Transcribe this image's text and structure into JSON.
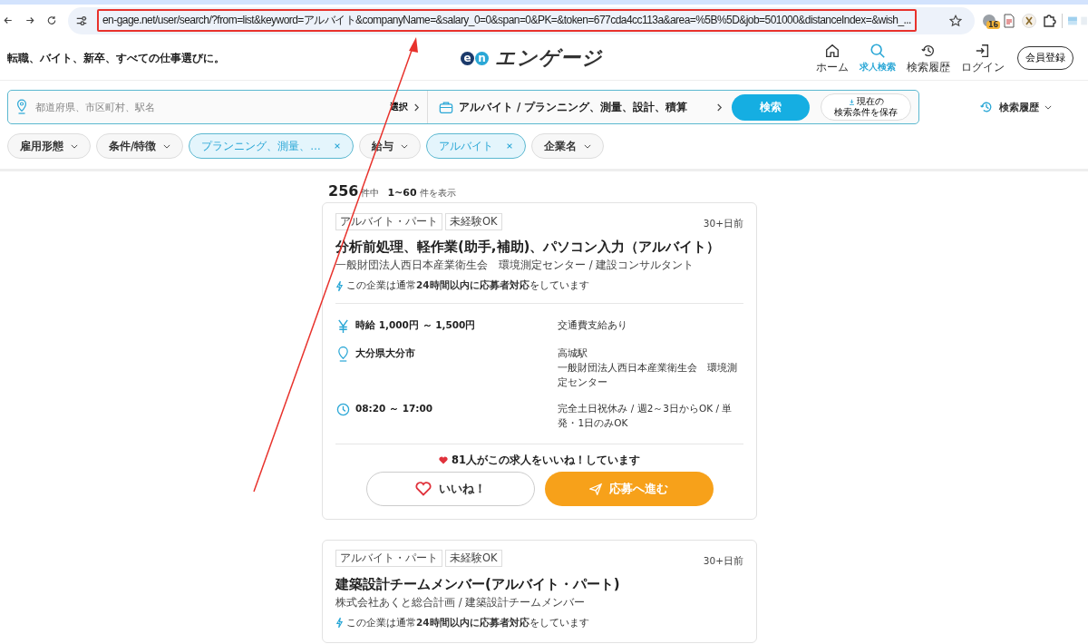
{
  "browser": {
    "url": "en-gage.net/user/search/?from=list&keyword=アルバイト&companyName=&salary_0=0&span=0&PK=&token=677cda4cc113a&area=%5B%5D&job=501000&distanceIndex=&wish_...",
    "extension_badge": "16"
  },
  "header": {
    "tagline": "転職、バイト、新卒、すべての仕事選びに。",
    "logo_mark": [
      "e",
      "n"
    ],
    "logo_text": "エンゲージ",
    "register_button": "会員登録",
    "nav": [
      {
        "label": "ホーム",
        "kind": "home",
        "selected": false
      },
      {
        "label": "求人検索",
        "kind": "search",
        "selected": true
      },
      {
        "label": "検索履歴",
        "kind": "history",
        "selected": false
      },
      {
        "label": "ログイン",
        "kind": "login",
        "selected": false
      }
    ]
  },
  "search": {
    "location_placeholder": "都道府県、市区町村、駅名",
    "location_select": "選択",
    "job_category": "アルバイト / プランニング、測量、設計、積算",
    "search_button": "検索",
    "save_button": [
      "現在の",
      "検索条件を保存"
    ],
    "history": "検索履歴"
  },
  "filters": [
    {
      "label": "雇用形態",
      "active": false
    },
    {
      "label": "条件/特徴",
      "active": false
    },
    {
      "label": "プランニング、測量、…",
      "active": true
    },
    {
      "label": "給与",
      "active": false
    },
    {
      "label": "アルバイト",
      "active": true
    },
    {
      "label": "企業名",
      "active": false
    }
  ],
  "results": {
    "total": "256",
    "total_suffix": "件中",
    "range": "1~60",
    "range_suffix": "件を表示"
  },
  "jobs": [
    {
      "tags": [
        "アルバイト・パート",
        "未経験OK"
      ],
      "posted": "30+日前",
      "title": "分析前処理、軽作業(助手,補助)、パソコン入力（アルバイト）",
      "company": "一般財団法人西日本産業衛生会　環境測定センター / 建設コンサルタント",
      "response_note": "この企業は通常**24時間以内に応募者対応**をしています",
      "details": [
        {
          "kind": "salary",
          "main": "時給 1,000円 ～ 1,500円",
          "extra": [
            "交通費支給あり"
          ]
        },
        {
          "kind": "location",
          "main": "大分県大分市",
          "extra": [
            "高城駅",
            "一般財団法人西日本産業衛生会　環境測定センター"
          ]
        },
        {
          "kind": "time",
          "main": "08:20 ～ 17:00",
          "extra": [
            "完全土日祝休み / 週2～3日からOK / 単発・1日のみOK"
          ]
        }
      ],
      "likes_note": "81人がこの求人をいいね！しています",
      "like_button": "いいね！",
      "apply_button": "応募へ進む"
    },
    {
      "tags": [
        "アルバイト・パート",
        "未経験OK"
      ],
      "posted": "30+日前",
      "title": "建築設計チームメンバー(アルバイト・パート)",
      "company": "株式会社あくと総合計画 / 建築設計チームメンバー",
      "response_note": "この企業は通常**24時間以内に応募者対応**をしています"
    }
  ]
}
